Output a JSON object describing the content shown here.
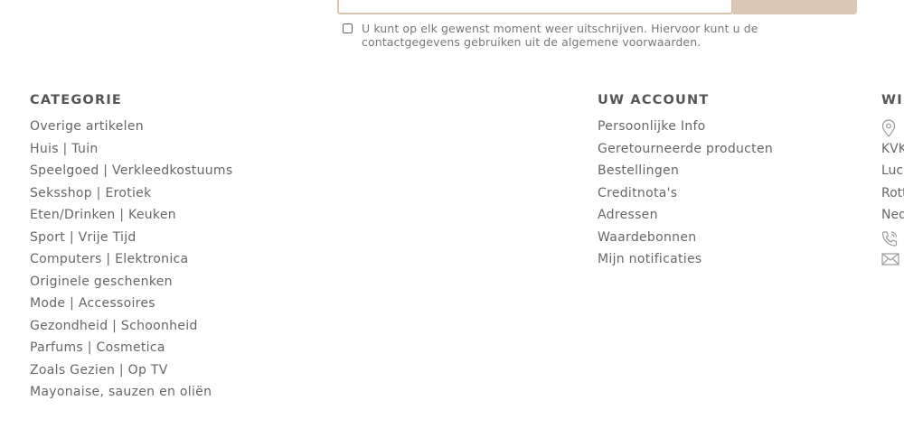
{
  "newsletter": {
    "consent_text": "U kunt op elk gewenst moment weer uitschrijven. Hiervoor kunt u de contactgegevens gebruiken uit de algemene voorwaarden."
  },
  "categorie": {
    "title": "CATEGORIE",
    "items": [
      "Overige artikelen",
      "Huis | Tuin",
      "Speelgoed | Verkleedkostuums",
      "Seksshop | Erotiek",
      "Eten/Drinken | Keuken",
      "Sport | Vrije Tijd",
      "Computers | Elektronica",
      "Originele geschenken",
      "Mode | Accessoires",
      "Gezondheid | Schoonheid",
      "Parfums | Cosmetica",
      "Zoals Gezien | Op TV",
      "Mayonaise, sauzen en oliën"
    ]
  },
  "account": {
    "title": "UW ACCOUNT",
    "items": [
      "Persoonlijke Info",
      "Geretourneerde producten",
      "Bestellingen",
      "Creditnota's",
      "Adressen",
      "Waardebonnen",
      "Mijn notificaties"
    ]
  },
  "store": {
    "title": "WI",
    "lines": [
      "KVK",
      "Luc",
      "Rott",
      "Ned"
    ],
    "icons": [
      "map-pin-icon",
      "phone-icon",
      "mail-icon"
    ]
  }
}
